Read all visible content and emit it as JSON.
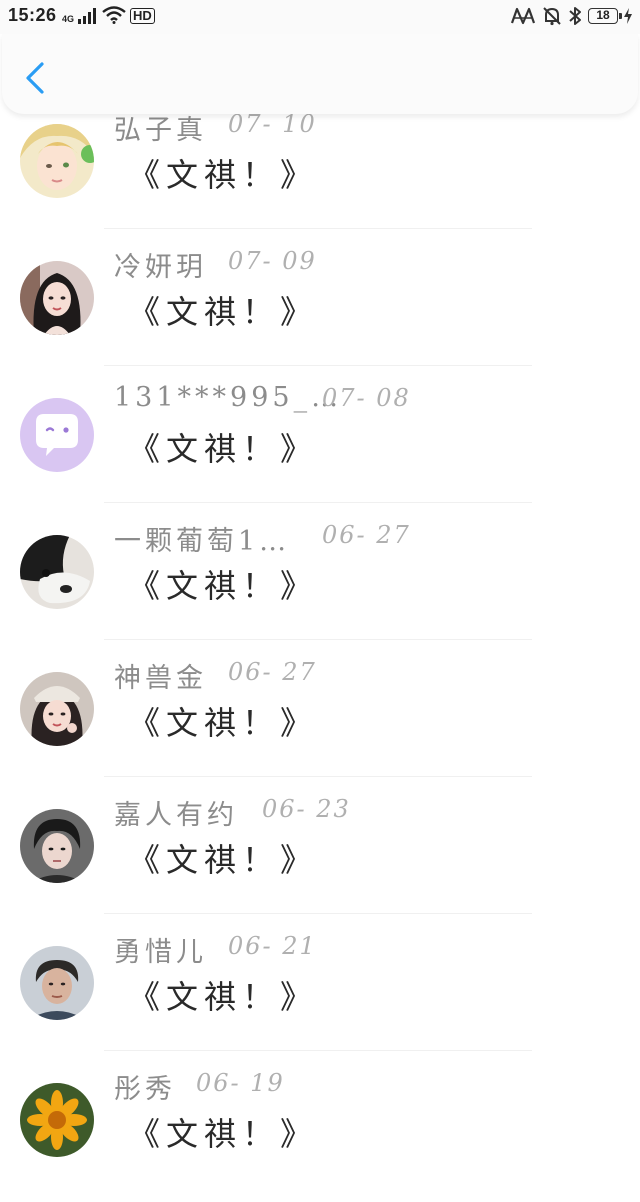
{
  "status_bar": {
    "time": "15:26",
    "network": "4G",
    "hd_label": "HD",
    "battery": "18"
  },
  "header": {
    "back_icon": "chevron-left-icon",
    "accent_color": "#2a9df4"
  },
  "comments": [
    {
      "name": "弘子真",
      "date": "07- 10",
      "message": "《文祺！》"
    },
    {
      "name": "冷妍玥",
      "date": "07- 09",
      "message": "《文祺！》"
    },
    {
      "name": "131***995_…",
      "date": "07- 08",
      "message": "《文祺！》"
    },
    {
      "name": "一颗葡萄1…",
      "date": "06- 27",
      "message": "《文祺！》"
    },
    {
      "name": "神兽金",
      "date": "06- 27",
      "message": "《文祺！》"
    },
    {
      "name": "嘉人有约",
      "date": "06- 23",
      "message": "《文祺！》"
    },
    {
      "name": "勇惜儿",
      "date": "06- 21",
      "message": "《文祺！》"
    },
    {
      "name": "彤秀",
      "date": "06- 19",
      "message": "《文祺！》"
    }
  ]
}
